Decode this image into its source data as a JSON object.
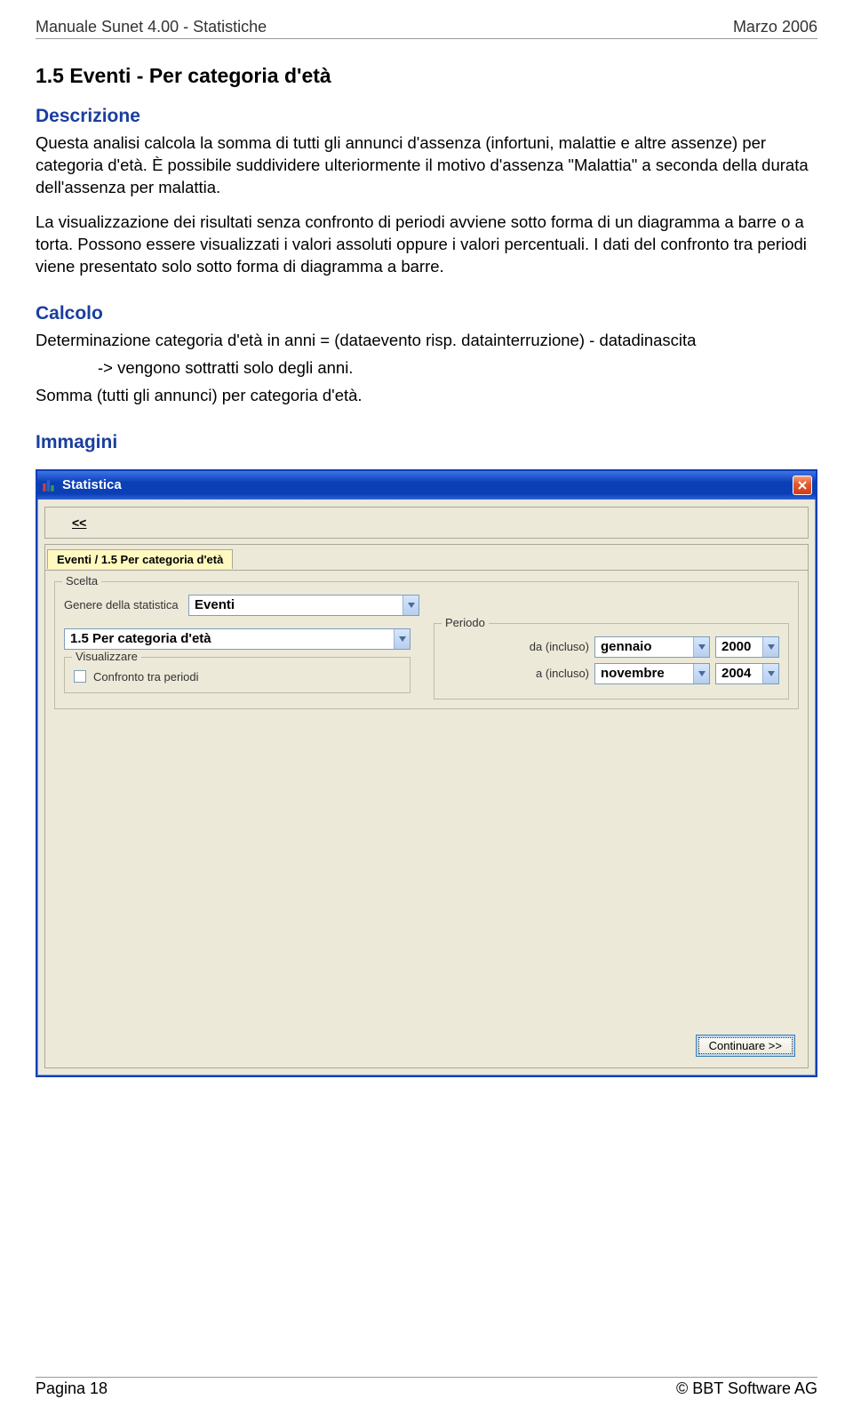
{
  "header": {
    "left": "Manuale Sunet 4.00 - Statistiche",
    "right": "Marzo 2006"
  },
  "section_title": "1.5   Eventi - Per categoria d'età",
  "descrizione": {
    "head": "Descrizione",
    "p1": "Questa analisi calcola la somma di tutti gli annunci d'assenza (infortuni, malattie e altre assenze) per categoria d'età. È possibile suddividere ulteriormente il motivo d'assenza \"Malattia\" a seconda della durata dell'assenza per malattia.",
    "p2": "La visualizzazione dei risultati senza confronto di periodi avviene sotto forma di un diagramma a barre o a torta. Possono essere visualizzati i valori assoluti oppure i valori percentuali. I dati del confronto tra periodi viene presentato solo sotto forma di diagramma a barre."
  },
  "calcolo": {
    "head": "Calcolo",
    "line1": "Determinazione categoria d'età in anni = (dataevento risp. datainterruzione) - datadinascita",
    "line2": "-> vengono sottratti solo degli anni.",
    "line3": "Somma (tutti gli annunci) per categoria d'età."
  },
  "immagini": {
    "head": "Immagini"
  },
  "window": {
    "title": "Statistica",
    "back_label": "<<",
    "tab_label": "Eventi / 1.5 Per categoria d'età",
    "scelta_legend": "Scelta",
    "genere_label": "Genere della statistica",
    "genere_value": "Eventi",
    "category_value": "1.5 Per categoria d'età",
    "visualizzare_legend": "Visualizzare",
    "confronto_label": "Confronto tra periodi",
    "periodo_legend": "Periodo",
    "da_label": "da (incluso)",
    "a_label": "a (incluso)",
    "da_month": "gennaio",
    "da_year": "2000",
    "a_month": "novembre",
    "a_year": "2004",
    "continue_label": "Continuare >>"
  },
  "footer": {
    "left": "Pagina 18",
    "right": "© BBT Software AG"
  }
}
